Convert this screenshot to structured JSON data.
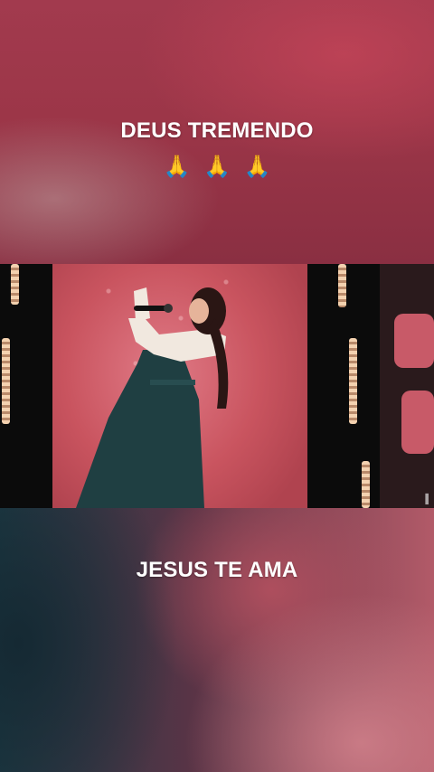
{
  "post": {
    "caption_top": "DEUS TREMENDO",
    "emoji": [
      "🙏",
      "🙏",
      "🙏"
    ],
    "caption_bottom": "JESUS TE AMA"
  },
  "colors": {
    "top_background": "#9c3648",
    "bottom_background_left": "#1d3a44",
    "bottom_background_right": "#b25a68",
    "stage": "#c9545f",
    "caption_text": "#ffffff"
  },
  "video": {
    "subject": "singer-with-microphone-on-stage"
  }
}
